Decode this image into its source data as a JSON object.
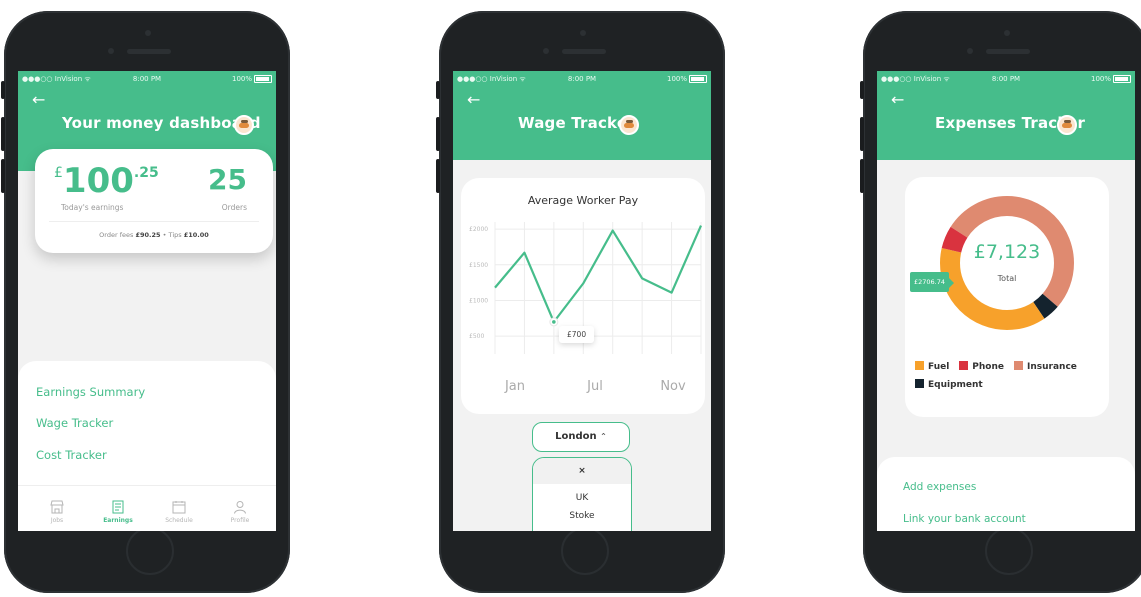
{
  "status": {
    "carrier": "●●●○○ InVision ᯤ",
    "time": "8:00 PM",
    "battery": "100%"
  },
  "phone1": {
    "title": "Your money dashboard",
    "currency": "£",
    "earnings_whole": "100",
    "earnings_cents": ".25",
    "earnings_label": "Today's earnings",
    "orders_value": "25",
    "orders_label": "Orders",
    "fees_prefix": "Order fees",
    "fees_value": "£90.25",
    "tips_prefix": "Tips",
    "tips_value": "£10.00",
    "menu": [
      "Earnings Summary",
      "Wage Tracker",
      "Cost Tracker"
    ],
    "tabs": [
      {
        "label": "Jobs",
        "icon": "store-icon"
      },
      {
        "label": "Earnings",
        "icon": "receipt-icon"
      },
      {
        "label": "Schedule",
        "icon": "calendar-icon"
      },
      {
        "label": "Profile",
        "icon": "person-icon"
      }
    ]
  },
  "phone2": {
    "title": "Wage Tracker",
    "chart_title": "Average Worker Pay",
    "tooltip": "£700",
    "location": "London",
    "dropdown": {
      "close": "×",
      "options": [
        "UK",
        "Stoke"
      ]
    }
  },
  "chart_data": {
    "type": "line",
    "title": "Average Worker Pay",
    "x_tick_labels": [
      "Jan",
      "Jul",
      "Nov"
    ],
    "y_tick_labels": [
      "£2000",
      "£1500",
      "£1000",
      "£500"
    ],
    "y_ticks": [
      2000,
      1500,
      1000,
      500
    ],
    "ylim": [
      250,
      2100
    ],
    "x": [
      0,
      1,
      2,
      3,
      4,
      5,
      6,
      7,
      8
    ],
    "values": [
      1180,
      1670,
      700,
      1240,
      1980,
      1310,
      1110,
      2050
    ],
    "highlight_index": 2,
    "color": "#46bd8b"
  },
  "phone3": {
    "title": "Expenses Tracker",
    "total": "£7,123",
    "total_label": "Total",
    "callout": "£2706.74",
    "legend": [
      {
        "label": "Fuel",
        "color": "#f7a12b"
      },
      {
        "label": "Phone",
        "color": "#d9333f"
      },
      {
        "label": "Insurance",
        "color": "#df8a70"
      },
      {
        "label": "Equipment",
        "color": "#14232e"
      }
    ],
    "donut": [
      {
        "name": "Insurance",
        "value": 3726,
        "color": "#df8a70"
      },
      {
        "name": "Equipment",
        "value": 300,
        "color": "#14232e"
      },
      {
        "name": "Fuel",
        "value": 2706.74,
        "color": "#f7a12b"
      },
      {
        "name": "Phone",
        "value": 390,
        "color": "#d9333f"
      }
    ],
    "links": [
      "Add expenses",
      "Link your bank account"
    ]
  },
  "colors": {
    "accent": "#46bd8b",
    "background": "#f2f2f2"
  }
}
